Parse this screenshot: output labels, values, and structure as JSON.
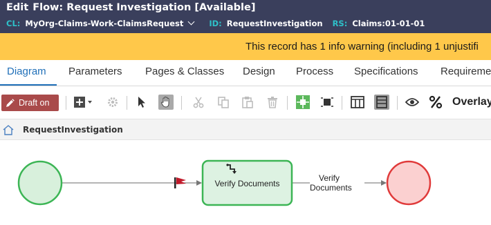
{
  "header": {
    "edit_label": "Edit",
    "title": "Flow: Request Investigation [Available]",
    "cl_key": "CL:",
    "cl_value": "MyOrg-Claims-Work-ClaimsRequest",
    "id_key": "ID:",
    "id_value": "RequestInvestigation",
    "rs_key": "RS:",
    "rs_value": "Claims:01-01-01"
  },
  "warning": {
    "text": "This record has 1 info warning (including 1 unjustifi"
  },
  "tabs": [
    {
      "label": "Diagram",
      "active": true
    },
    {
      "label": "Parameters"
    },
    {
      "label": "Pages & Classes"
    },
    {
      "label": "Design"
    },
    {
      "label": "Process"
    },
    {
      "label": "Specifications"
    },
    {
      "label": "Requireme"
    }
  ],
  "toolbar": {
    "draft_label": "Draft on",
    "overlay_label": "Overlay"
  },
  "breadcrumb": {
    "label": "RequestInvestigation"
  },
  "flow": {
    "task_label": "Verify Documents",
    "connector_label_line1": "Verify",
    "connector_label_line2": "Documents"
  },
  "colors": {
    "header_bg": "#3a3f5c",
    "meta_key": "#2ec0c9",
    "warning_bg": "#ffc84a",
    "tab_active": "#1f6fb8",
    "draft_bg": "#a94a4a",
    "start_fill": "#d8f0dc",
    "start_stroke": "#3cb555",
    "end_fill": "#fbd0d0",
    "end_stroke": "#e03a3a",
    "task_fill": "#ddf2e2",
    "task_stroke": "#3cb555"
  },
  "icons": [
    "pencil-icon",
    "add-icon",
    "settings-icon",
    "pointer-icon",
    "hand-icon",
    "cut-icon",
    "copy-icon",
    "paste-icon",
    "delete-icon",
    "node-icon",
    "fit-icon",
    "single-panel-icon",
    "double-panel-icon",
    "eye-icon",
    "percent-icon",
    "home-icon",
    "flag-icon",
    "subprocess-icon"
  ]
}
